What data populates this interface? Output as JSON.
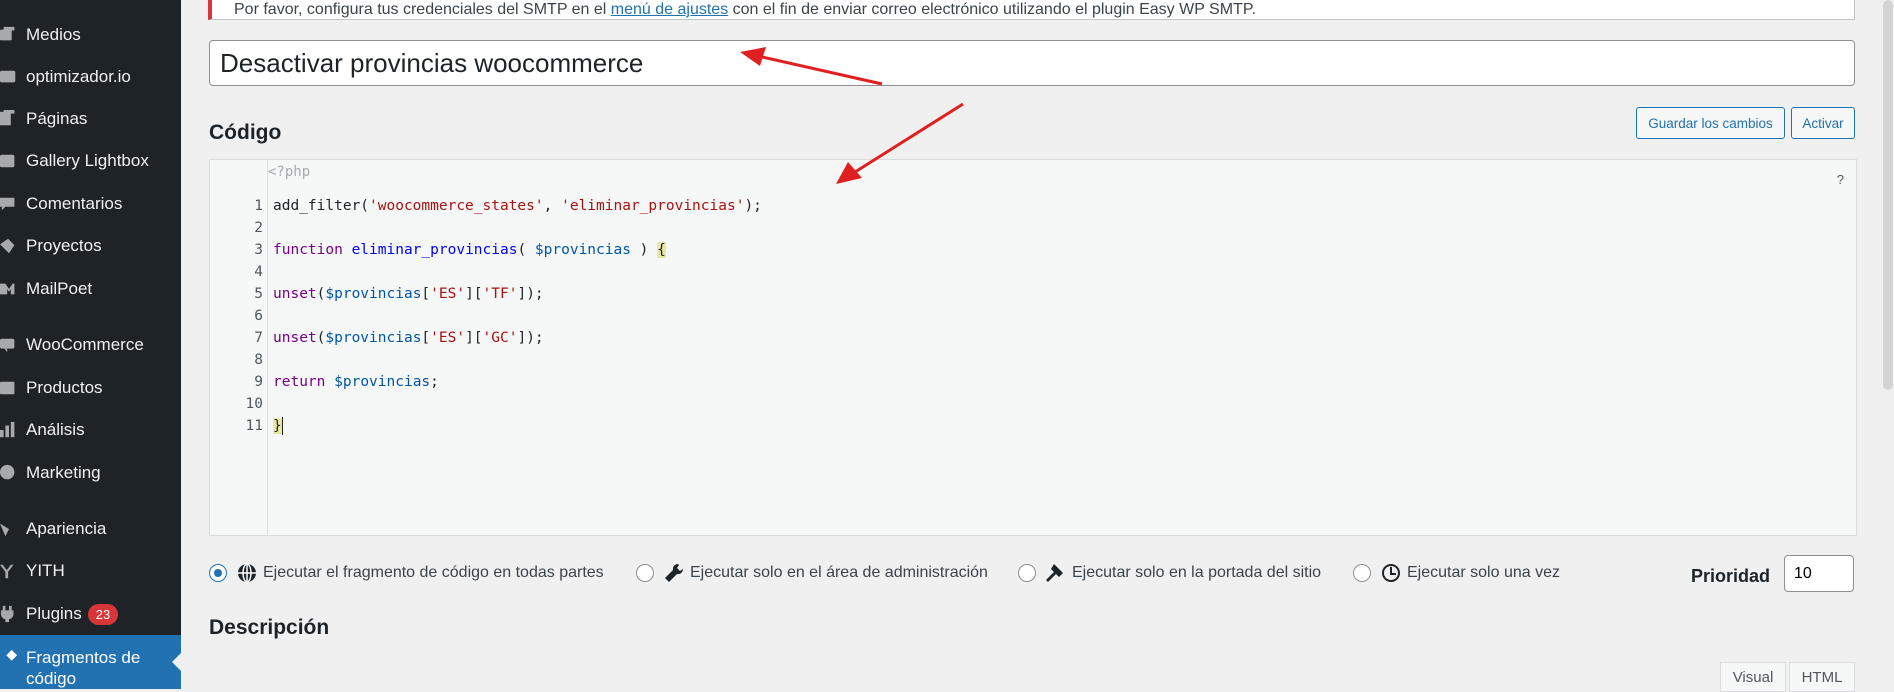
{
  "sidebar": {
    "items": [
      {
        "label": "Medios",
        "icon": "media-icon"
      },
      {
        "label": "optimizador.io",
        "icon": "optimizer-icon"
      },
      {
        "label": "Páginas",
        "icon": "pages-icon"
      },
      {
        "label": "Gallery Lightbox",
        "icon": "gallery-icon"
      },
      {
        "label": "Comentarios",
        "icon": "comments-icon"
      },
      {
        "label": "Proyectos",
        "icon": "projects-icon"
      },
      {
        "label": "MailPoet",
        "icon": "mailpoet-icon"
      },
      {
        "label": "WooCommerce",
        "icon": "woocommerce-icon"
      },
      {
        "label": "Productos",
        "icon": "products-icon"
      },
      {
        "label": "Análisis",
        "icon": "analytics-icon"
      },
      {
        "label": "Marketing",
        "icon": "marketing-icon"
      },
      {
        "label": "Apariencia",
        "icon": "appearance-icon"
      },
      {
        "label": "YITH",
        "icon": "yith-icon"
      },
      {
        "label": "Plugins",
        "icon": "plugins-icon",
        "badge": "23"
      },
      {
        "label": "Fragmentos de código",
        "icon": "code-snippets-icon",
        "active": true
      }
    ]
  },
  "notice": {
    "prefix": "Por favor, configura tus credenciales del SMTP en el ",
    "link": "menú de ajustes",
    "suffix": " con el fin de enviar correo electrónico utilizando el plugin Easy WP SMTP."
  },
  "snippet": {
    "title": "Desactivar provincias woocommerce"
  },
  "code_section": {
    "heading": "Código",
    "save_label": "Guardar los cambios",
    "activate_label": "Activar",
    "php_open": "<?php",
    "help": "?"
  },
  "code_lines": [
    {
      "n": "1"
    },
    {
      "n": "2"
    },
    {
      "n": "3"
    },
    {
      "n": "4"
    },
    {
      "n": "5"
    },
    {
      "n": "6"
    },
    {
      "n": "7"
    },
    {
      "n": "8"
    },
    {
      "n": "9"
    },
    {
      "n": "10"
    },
    {
      "n": "11"
    }
  ],
  "code_tokens": {
    "l1": [
      "add_filter(",
      "'woocommerce_states'",
      ", ",
      "'eliminar_provincias'",
      ");"
    ],
    "l3": [
      "function",
      " ",
      "eliminar_provincias",
      "( ",
      "$provincias",
      " ) ",
      "{"
    ],
    "l5": [
      "unset",
      "(",
      "$provincias",
      "[",
      "'ES'",
      "][",
      "'TF'",
      "]);"
    ],
    "l7": [
      "unset",
      "(",
      "$provincias",
      "[",
      "'ES'",
      "][",
      "'GC'",
      "]);"
    ],
    "l9": [
      "return",
      " ",
      "$provincias",
      ";"
    ],
    "l11": [
      "}"
    ]
  },
  "scope": {
    "options": [
      {
        "label": "Ejecutar el fragmento de código en todas partes",
        "icon": "globe-icon",
        "checked": true
      },
      {
        "label": "Ejecutar solo en el área de administración",
        "icon": "wrench-icon",
        "checked": false
      },
      {
        "label": "Ejecutar solo en la portada del sitio",
        "icon": "hammer-icon",
        "checked": false
      },
      {
        "label": "Ejecutar solo una vez",
        "icon": "clock-icon",
        "checked": false
      }
    ]
  },
  "priority": {
    "label": "Prioridad",
    "value": "10"
  },
  "description": {
    "heading": "Descripción",
    "visual_tab": "Visual",
    "html_tab": "HTML"
  },
  "colors": {
    "sidebar_bg": "#1d2327",
    "active_bg": "#2271b1",
    "annotation_arrow": "#e02020"
  }
}
